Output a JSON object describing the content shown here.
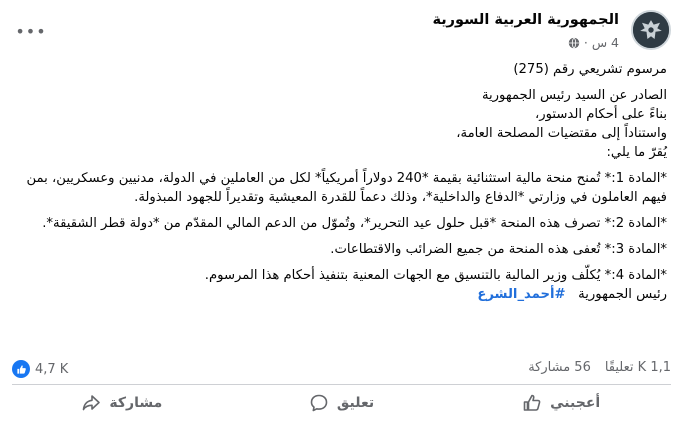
{
  "post": {
    "page_name": "الجمهورية العربية السورية",
    "time": "4 س",
    "separator": "·",
    "more_label": "•••",
    "lines": {
      "l1": "مرسوم تشريعي رقم (275)",
      "l2": "الصادر عن السيد رئيس الجمهورية",
      "l3": "بناءً على أحكام الدستور،",
      "l4": "واستناداً إلى مقتضيات المصلحة العامة،",
      "l5": "يُقرّ ما يلي:",
      "l6": "*المادة 1:* تُمنح منحة مالية استثنائية بقيمة *240 دولاراً أمريكياً* لكل من العاملين في الدولة، مدنيين وعسكريين، بمن فيهم العاملون في وزارتي *الدفاع والداخلية*، وذلك دعماً للقدرة المعيشية وتقديراً للجهود المبذولة.",
      "l7": "*المادة 2:* تصرف هذه المنحة *قبل حلول عيد التحرير*، وتُموّل من الدعم المالي المقدّم من *دولة قطر الشقيقة*.",
      "l8": "*المادة 3:* تُعفى هذه المنحة من جميع الضرائب والاقتطاعات.",
      "l9": "*المادة 4:* يُكلّف وزير المالية بالتنسيق مع الجهات المعنية بتنفيذ أحكام هذا المرسوم.",
      "l10_prefix": "رئيس الجمهورية",
      "hashtag": "#أحمد_الشرع"
    }
  },
  "stats": {
    "reactions_count": "4,7 K",
    "comments": "1,1 K تعليقًا",
    "shares": "56 مشاركة"
  },
  "actions": {
    "like": "أعجبني",
    "comment": "تعليق",
    "share": "مشاركة"
  },
  "colors": {
    "link": "#216fdb",
    "secondary_text": "#65676b",
    "like_blue": "#1877f2"
  },
  "icons": [
    "globe-icon",
    "more-icon",
    "like-reaction-icon",
    "like-icon",
    "comment-icon",
    "share-icon"
  ]
}
